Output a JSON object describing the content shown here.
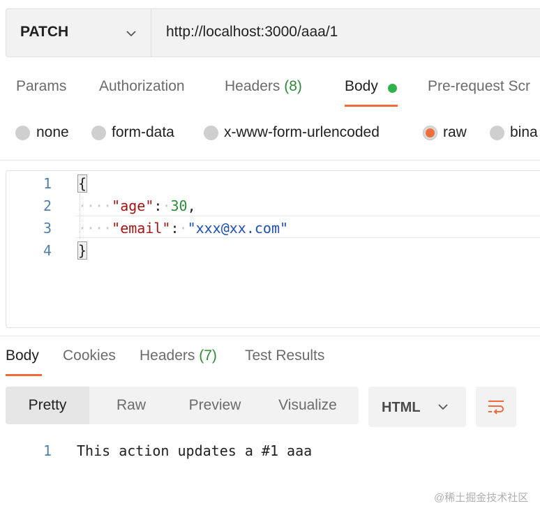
{
  "request": {
    "method": "PATCH",
    "url": "http://localhost:3000/aaa/1"
  },
  "request_tabs": [
    {
      "label": "Params"
    },
    {
      "label": "Authorization"
    },
    {
      "label": "Headers",
      "count": "(8)"
    },
    {
      "label": "Body",
      "active": true
    },
    {
      "label": "Pre-request Scr"
    }
  ],
  "body_types": [
    {
      "label": "none"
    },
    {
      "label": "form-data"
    },
    {
      "label": "x-www-form-urlencoded"
    },
    {
      "label": "raw",
      "selected": true
    },
    {
      "label": "bina"
    }
  ],
  "editor": {
    "line_numbers": [
      "1",
      "2",
      "3",
      "4"
    ],
    "lines": {
      "open_brace": "{",
      "age_key": "\"age\"",
      "age_value": "30",
      "email_key": "\"email\"",
      "email_value": "\"xxx@xx.com\"",
      "close_brace": "}"
    }
  },
  "response_tabs": [
    {
      "label": "Body",
      "active": true
    },
    {
      "label": "Cookies"
    },
    {
      "label": "Headers",
      "count": "(7)"
    },
    {
      "label": "Test Results"
    }
  ],
  "view_modes": [
    "Pretty",
    "Raw",
    "Preview",
    "Visualize"
  ],
  "format": "HTML",
  "response": {
    "line_number": "1",
    "text": "This action updates a #1 aaa"
  },
  "watermark": "@稀土掘金技术社区",
  "colors": {
    "accent": "#ef6b3b",
    "body_indicator": "#2fb14d",
    "count": "#2f8a3a"
  },
  "icons": [
    "chevron-down-icon",
    "wrap-lines-icon"
  ]
}
